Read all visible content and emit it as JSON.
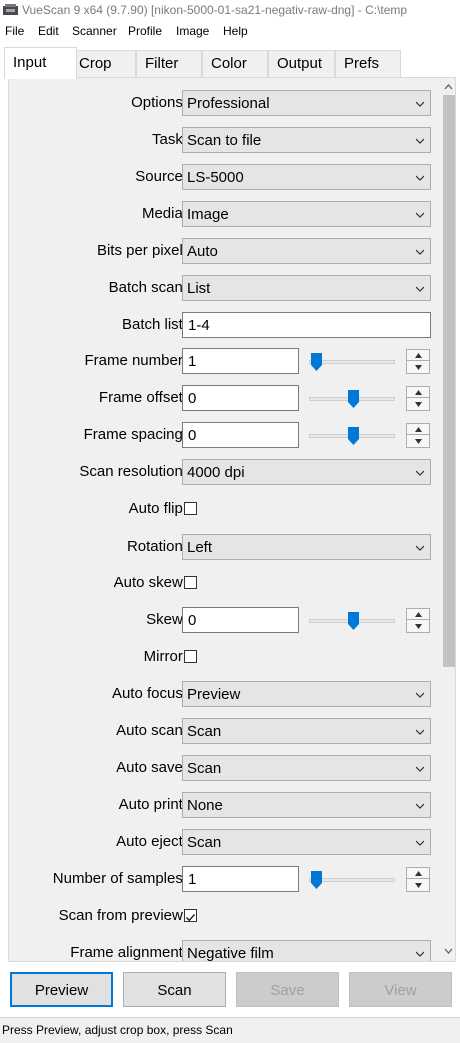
{
  "window": {
    "title": "VueScan 9 x64 (9.7.90) [nikon-5000-01-sa21-negativ-raw-dng] - C:\\temp"
  },
  "menu": [
    "File",
    "Edit",
    "Scanner",
    "Profile",
    "Image",
    "Help"
  ],
  "tabs": [
    "Input",
    "Crop",
    "Filter",
    "Color",
    "Output",
    "Prefs"
  ],
  "active_tab": "Input",
  "form": {
    "options": {
      "label": "Options:",
      "value": "Professional"
    },
    "task": {
      "label": "Task:",
      "value": "Scan to file"
    },
    "source": {
      "label": "Source:",
      "value": "LS-5000"
    },
    "media": {
      "label": "Media:",
      "value": "Image"
    },
    "bits_per_pixel": {
      "label": "Bits per pixel:",
      "value": "Auto"
    },
    "batch_scan": {
      "label": "Batch scan:",
      "value": "List"
    },
    "batch_list": {
      "label": "Batch list:",
      "value": "1-4"
    },
    "frame_number": {
      "label": "Frame number:",
      "value": "1",
      "slider_level": 0.0
    },
    "frame_offset": {
      "label": "Frame offset:",
      "value": "0",
      "slider_level": 0.5
    },
    "frame_spacing": {
      "label": "Frame spacing:",
      "value": "0",
      "slider_level": 0.5
    },
    "scan_resolution": {
      "label": "Scan resolution:",
      "value": "4000 dpi"
    },
    "auto_flip": {
      "label": "Auto flip:",
      "checked": false
    },
    "rotation": {
      "label": "Rotation:",
      "value": "Left"
    },
    "auto_skew": {
      "label": "Auto skew:",
      "checked": false
    },
    "skew": {
      "label": "Skew:",
      "value": "0",
      "slider_level": 0.5
    },
    "mirror": {
      "label": "Mirror:",
      "checked": false
    },
    "auto_focus": {
      "label": "Auto focus:",
      "value": "Preview"
    },
    "auto_scan": {
      "label": "Auto scan:",
      "value": "Scan"
    },
    "auto_save": {
      "label": "Auto save:",
      "value": "Scan"
    },
    "auto_print": {
      "label": "Auto print:",
      "value": "None"
    },
    "auto_eject": {
      "label": "Auto eject:",
      "value": "Scan"
    },
    "number_of_samples": {
      "label": "Number of samples:",
      "value": "1",
      "slider_level": 0.0
    },
    "scan_from_preview": {
      "label": "Scan from preview:",
      "checked": true
    },
    "frame_alignment": {
      "label": "Frame alignment:",
      "value": "Negative film"
    }
  },
  "buttons": {
    "preview": "Preview",
    "scan": "Scan",
    "save": "Save",
    "view": "View"
  },
  "status": "Press Preview, adjust crop box, press Scan",
  "colors": {
    "accent": "#0078d7",
    "panel_bg": "#f0f0f0",
    "disabled_text": "#a0a0a0"
  },
  "icons": [
    "app-icon",
    "chevron-down-icon",
    "spin-up-icon",
    "spin-down-icon",
    "checkmark-icon",
    "scroll-up-icon",
    "scroll-down-icon"
  ]
}
